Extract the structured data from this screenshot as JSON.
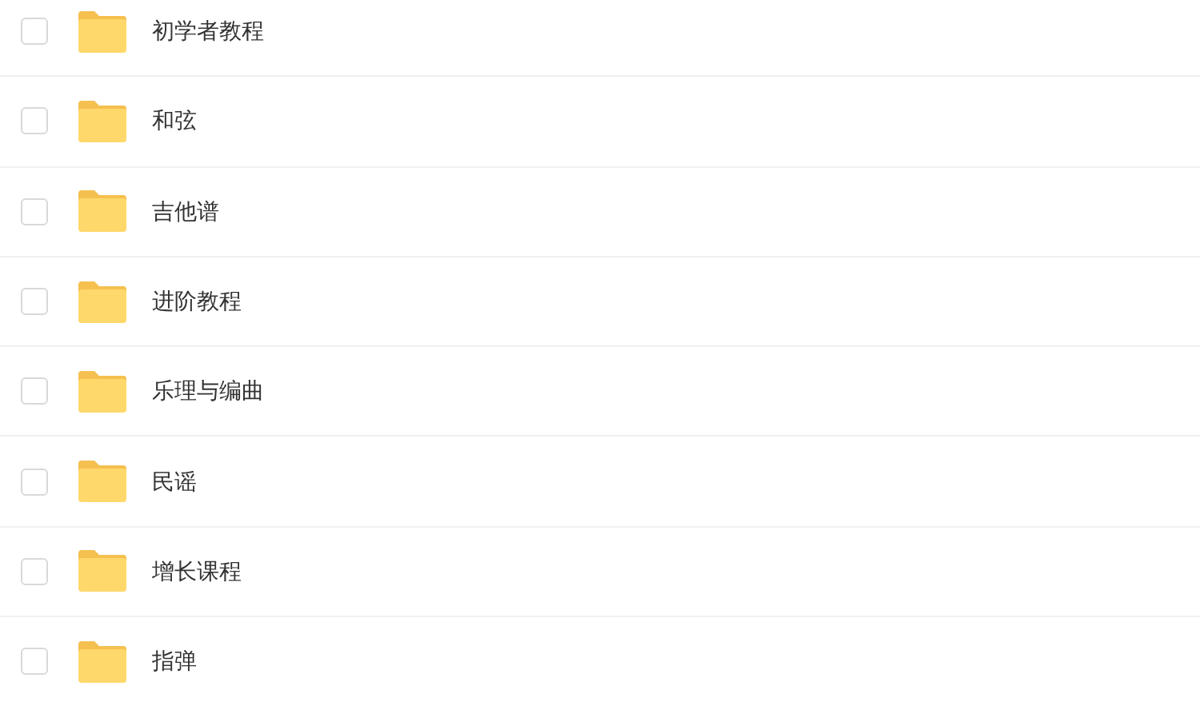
{
  "folders": [
    {
      "name": "初学者教程",
      "checked": false
    },
    {
      "name": "和弦",
      "checked": false
    },
    {
      "name": "吉他谱",
      "checked": false
    },
    {
      "name": "进阶教程",
      "checked": false
    },
    {
      "name": "乐理与编曲",
      "checked": false
    },
    {
      "name": "民谣",
      "checked": false
    },
    {
      "name": "增长课程",
      "checked": false
    },
    {
      "name": "指弹",
      "checked": false
    }
  ]
}
